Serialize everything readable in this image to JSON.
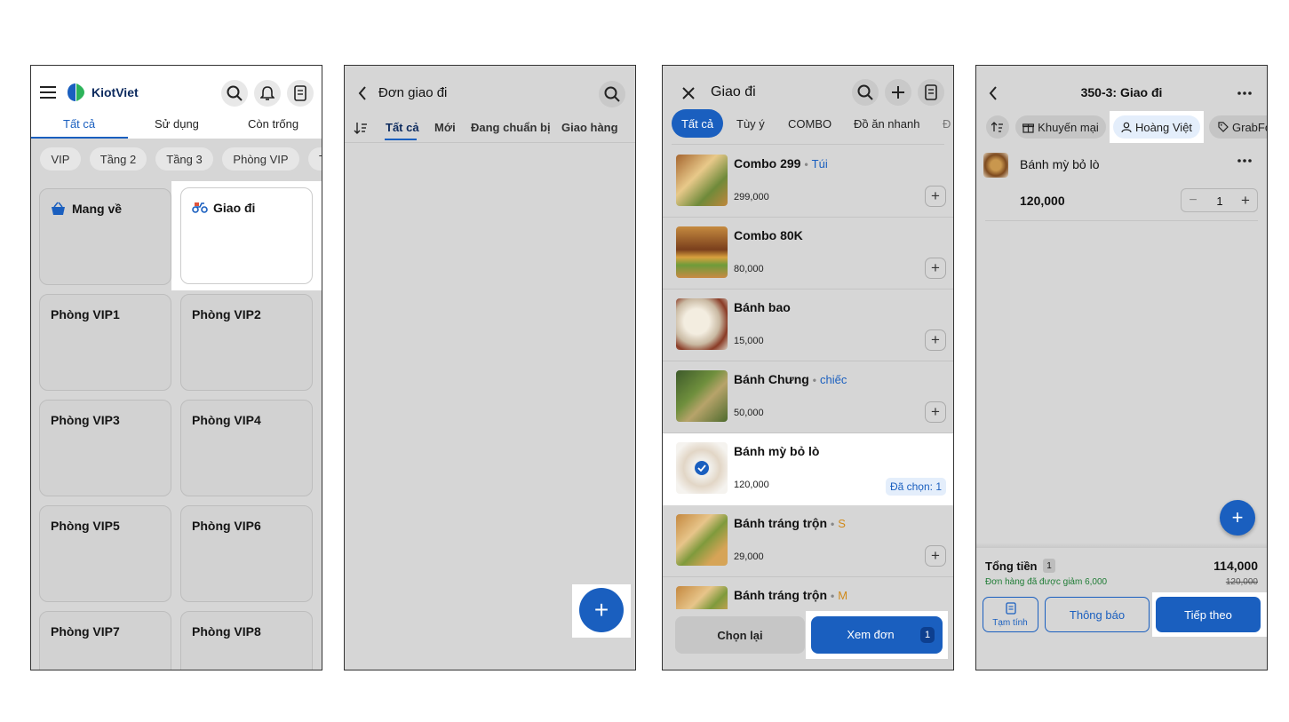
{
  "screen1": {
    "brand": "KiotViet",
    "tabs": [
      "Tất cả",
      "Sử dụng",
      "Còn trống"
    ],
    "filters": [
      "VIP",
      "Tầng 2",
      "Tầng 3",
      "Phòng VIP",
      "T"
    ],
    "tiles": [
      {
        "label": "Mang về"
      },
      {
        "label": "Giao đi"
      },
      {
        "label": "Phòng VIP1"
      },
      {
        "label": "Phòng VIP2"
      },
      {
        "label": "Phòng VIP3"
      },
      {
        "label": "Phòng VIP4"
      },
      {
        "label": "Phòng VIP5"
      },
      {
        "label": "Phòng VIP6"
      },
      {
        "label": "Phòng VIP7"
      },
      {
        "label": "Phòng VIP8"
      }
    ],
    "menu_icon": "hamburger-icon",
    "colors": {
      "accent": "#1a5fbf",
      "highlight": "#ffffff"
    }
  },
  "screen2": {
    "title": "Đơn giao đi",
    "tabs": [
      "Tất cả",
      "Mới",
      "Đang chuẩn bị",
      "Giao hàng"
    ],
    "fab": "+"
  },
  "screen3": {
    "title": "Giao đi",
    "categories": [
      "Tất cả",
      "Tùy ý",
      "COMBO",
      "Đồ ăn nhanh",
      "Đ"
    ],
    "items": [
      {
        "name": "Combo 299",
        "unit": "Túi",
        "price": "299,000"
      },
      {
        "name": "Combo 80K",
        "unit": "",
        "price": "80,000"
      },
      {
        "name": "Bánh bao",
        "unit": "",
        "price": "15,000"
      },
      {
        "name": "Bánh Chưng",
        "unit": "chiếc",
        "price": "50,000"
      },
      {
        "name": "Bánh mỳ bỏ lò",
        "unit": "",
        "price": "120,000",
        "selected_label": "Đã chọn: 1"
      },
      {
        "name": "Bánh tráng trộn",
        "unit": "S",
        "price": "29,000"
      },
      {
        "name": "Bánh tráng trộn",
        "unit": "M",
        "price": ""
      }
    ],
    "reset_label": "Chọn lại",
    "view_order_label": "Xem đơn",
    "view_order_count": "1"
  },
  "screen4": {
    "title": "350-3: Giao đi",
    "chips": [
      "Khuyến mại",
      "Hoàng Việt",
      "GrabFo"
    ],
    "item": {
      "name": "Bánh mỳ bỏ lò",
      "price": "120,000",
      "qty": "1"
    },
    "total_label": "Tổng tiền",
    "total_count": "1",
    "total_value": "114,000",
    "discount_note": "Đơn hàng đã được giảm 6,000",
    "original_total": "120,000",
    "temp_label": "Tạm tính",
    "notify_label": "Thông báo",
    "next_label": "Tiếp theo",
    "fab": "+"
  }
}
